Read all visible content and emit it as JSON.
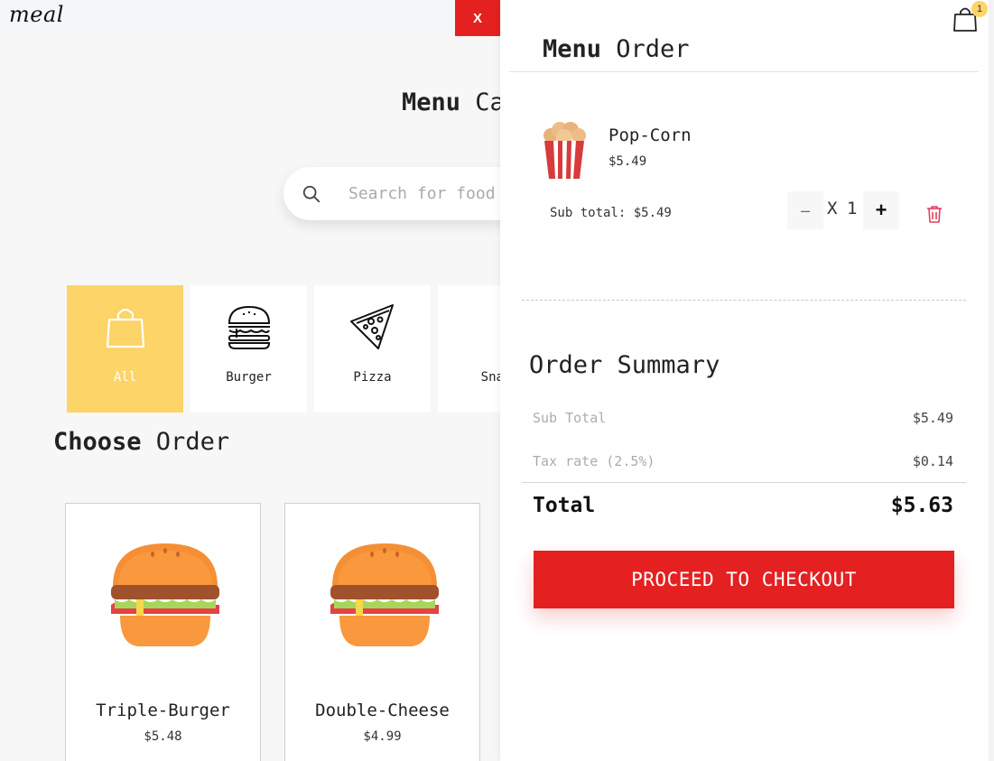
{
  "header": {
    "logo": "meal",
    "close_label": "X"
  },
  "menu": {
    "title_strong": "Menu",
    "title_rest": " Ca"
  },
  "search": {
    "placeholder": "Search for food"
  },
  "categories": [
    {
      "label": "All",
      "icon": "shopping-bag-icon",
      "active": true
    },
    {
      "label": "Burger",
      "icon": "burger-icon",
      "active": false
    },
    {
      "label": "Pizza",
      "icon": "pizza-icon",
      "active": false
    },
    {
      "label": "Snac",
      "icon": "snack-icon",
      "active": false
    }
  ],
  "choose": {
    "title_strong": "Choose",
    "title_rest": " Order"
  },
  "products": [
    {
      "name": "Triple-Burger",
      "price": "$5.48"
    },
    {
      "name": "Double-Cheese",
      "price": "$4.99"
    }
  ],
  "cart": {
    "title_strong": "Menu",
    "title_rest": " Order",
    "badge_count": "1",
    "item": {
      "name": "Pop-Corn",
      "price": "$5.49",
      "subtotal": "Sub total: $5.49",
      "qty_minus": "–",
      "qty_x": "X",
      "quantity": "1",
      "qty_plus": "+"
    },
    "summary": {
      "title": "Order Summary",
      "subtotal_label": "Sub Total",
      "subtotal_value": "$5.49",
      "tax_label": "Tax rate (2.5%)",
      "tax_value": "$0.14",
      "total_label": "Total",
      "total_value": "$5.63"
    },
    "checkout_label": "PROCEED TO CHECKOUT"
  },
  "colors": {
    "accent_red": "#e52020",
    "accent_yellow": "#fcd467"
  }
}
